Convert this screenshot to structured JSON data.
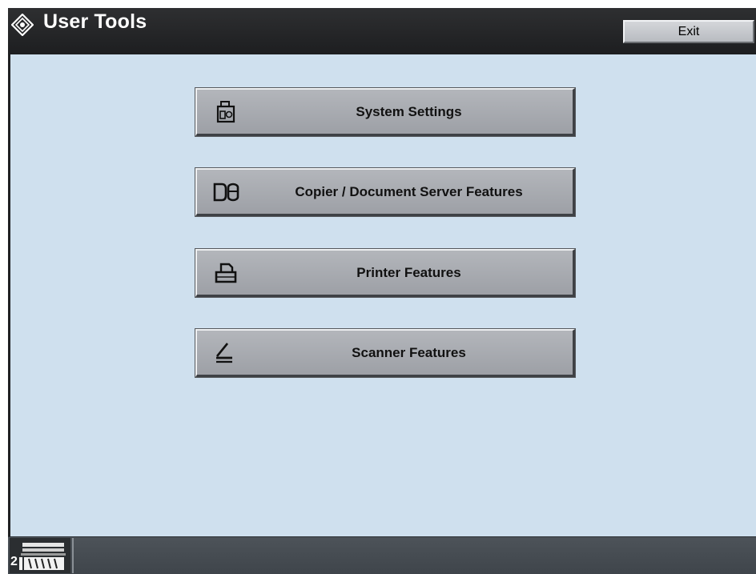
{
  "window": {
    "title": "User Tools",
    "title_icon": "user-tools-diamond-icon",
    "exit_label": "Exit"
  },
  "menu": {
    "items": [
      {
        "label": "System Settings",
        "icon": "system-settings-icon"
      },
      {
        "label": "Copier / Document Server Features",
        "icon": "copier-document-server-icon"
      },
      {
        "label": "Printer Features",
        "icon": "printer-icon"
      },
      {
        "label": "Scanner Features",
        "icon": "scanner-icon"
      }
    ]
  },
  "status": {
    "tray_number": "2",
    "tray_icon": "paper-tray-icon"
  },
  "colors": {
    "content_background": "#cfe0ee",
    "titlebar": "#1f2022",
    "button_face": "#a8abb0",
    "statusbar": "#464c52"
  }
}
